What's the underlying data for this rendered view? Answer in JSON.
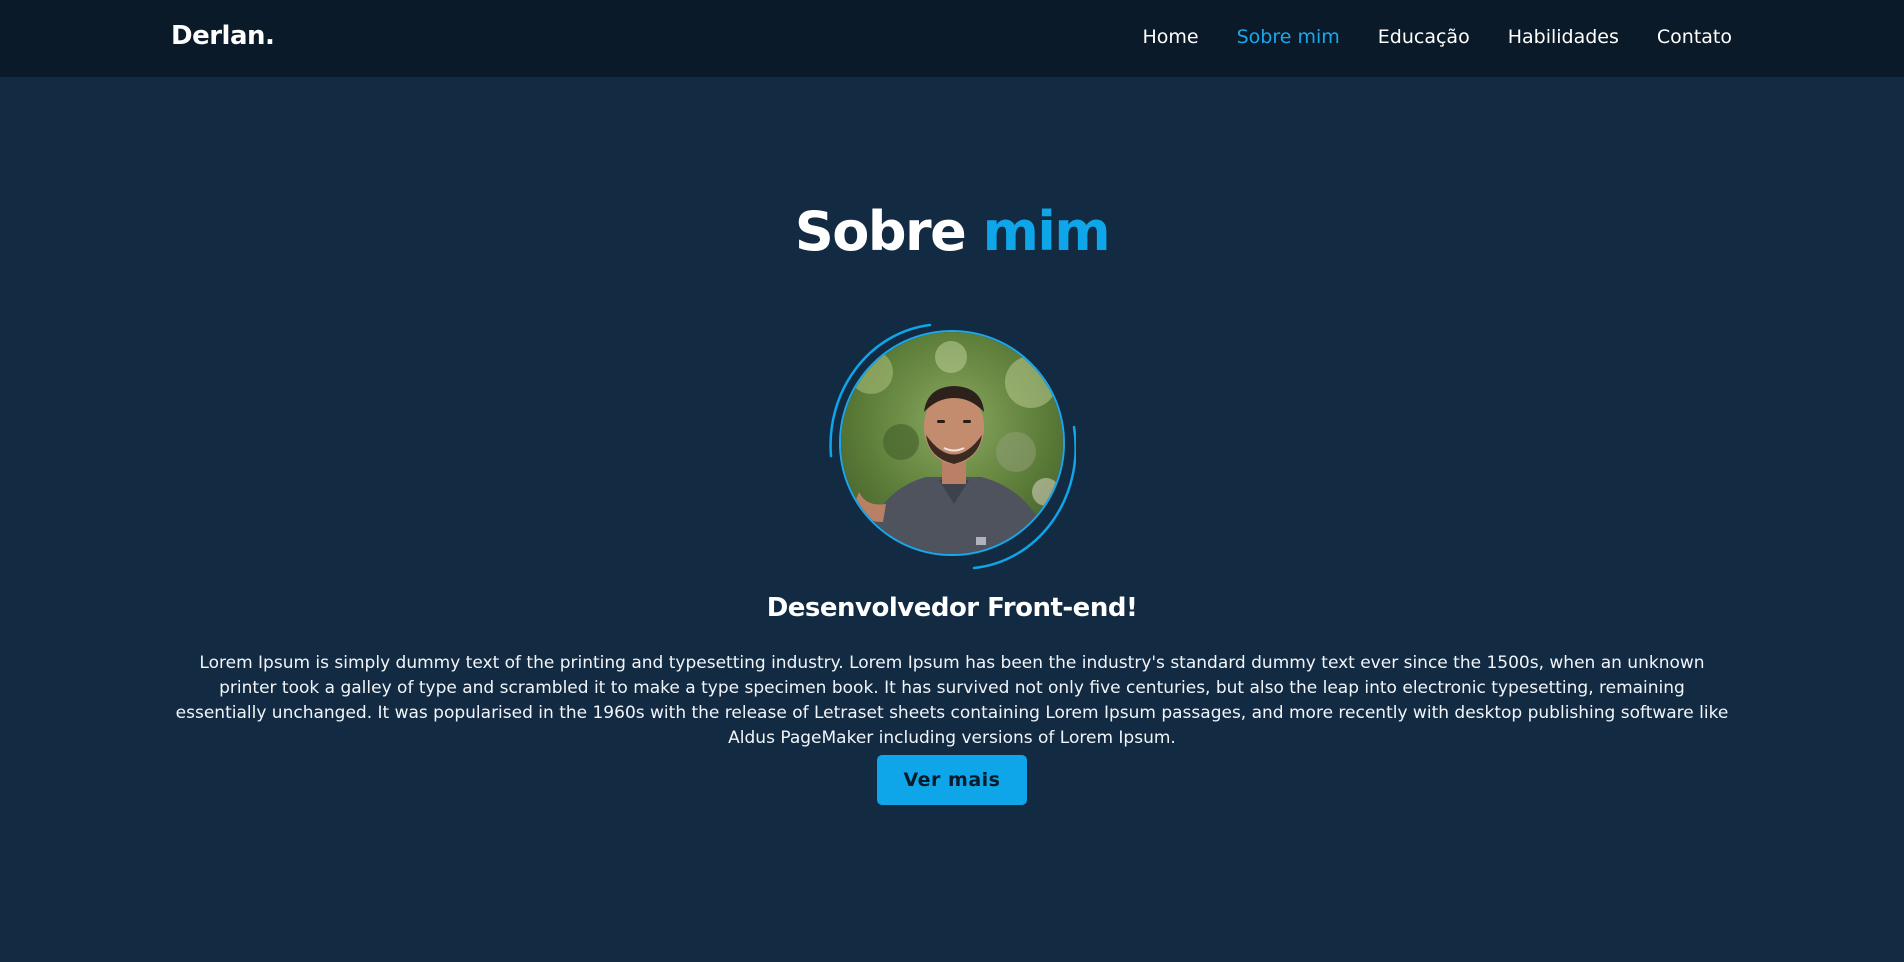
{
  "navbar": {
    "logo": "Derlan.",
    "links": [
      {
        "label": "Home",
        "active": false
      },
      {
        "label": "Sobre mim",
        "active": true
      },
      {
        "label": "Educação",
        "active": false
      },
      {
        "label": "Habilidades",
        "active": false
      },
      {
        "label": "Contato",
        "active": false
      }
    ]
  },
  "about": {
    "title_part1": "Sobre",
    "title_part2": "mim",
    "subtitle": "Desenvolvedor Front-end!",
    "description": "Lorem Ipsum is simply dummy text of the printing and typesetting industry. Lorem Ipsum has been the industry's standard dummy text ever since the 1500s, when an unknown printer took a galley of type and scrambled it to make a type specimen book. It has survived not only five centuries, but also the leap into electronic typesetting, remaining essentially unchanged. It was popularised in the 1960s with the release of Letraset sheets containing Lorem Ipsum passages, and more recently with desktop publishing software like Aldus PageMaker including versions of Lorem Ipsum.",
    "button_label": "Ver mais"
  },
  "colors": {
    "background": "#132b42",
    "navbar": "#0b1a28",
    "accent": "#0ea5e9"
  }
}
